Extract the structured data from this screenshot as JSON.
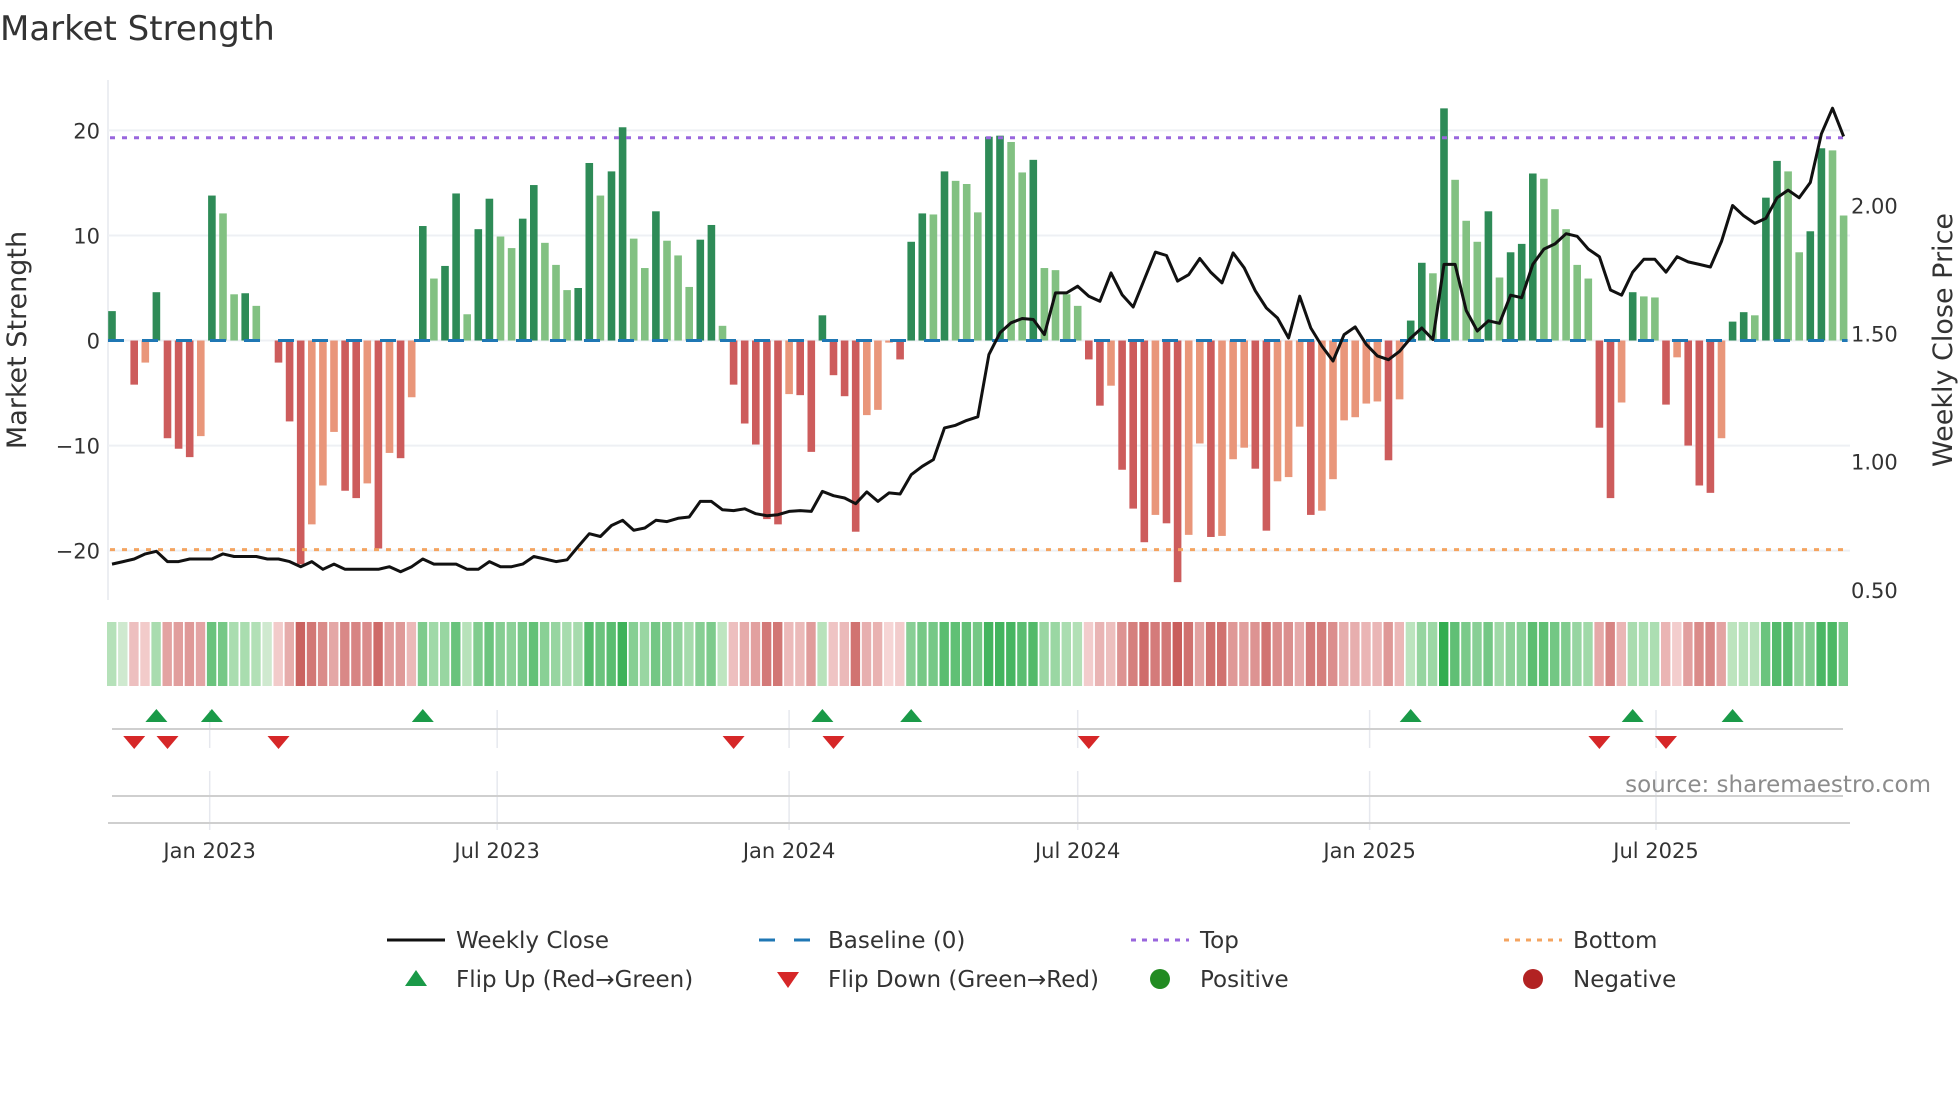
{
  "chart_data": {
    "type": "bar",
    "title": "Market Strength",
    "ylabel": "Market Strength",
    "ylabel_right": "Weekly Close Price",
    "ylim": [
      -24.7,
      24.8
    ],
    "ylim_right": [
      0.46,
      2.49
    ],
    "yticks": [
      {
        "value": 20,
        "label": "20"
      },
      {
        "value": 10,
        "label": "10"
      },
      {
        "value": 0,
        "label": "0"
      },
      {
        "value": -10,
        "label": "−10"
      },
      {
        "value": -20,
        "label": "−20"
      }
    ],
    "yticks_right": [
      {
        "value": 0.5,
        "label": "0.50"
      },
      {
        "value": 1.0,
        "label": "1.00"
      },
      {
        "value": 1.5,
        "label": "1.50"
      },
      {
        "value": 2.0,
        "label": "2.00"
      }
    ],
    "xticks": [
      {
        "week": 8.8,
        "label": "Jan 2023"
      },
      {
        "week": 34.7,
        "label": "Jul 2023"
      },
      {
        "week": 61.0,
        "label": "Jan 2024"
      },
      {
        "week": 87.0,
        "label": "Jul 2024"
      },
      {
        "week": 113.3,
        "label": "Jan 2025"
      },
      {
        "week": 139.1,
        "label": "Jul 2025"
      }
    ],
    "grid": true,
    "top_level": 19.3,
    "bottom_level": -19.9,
    "baseline": 0,
    "series": [
      {
        "name": "Market Strength",
        "type": "bar",
        "values": [
          2.8,
          0,
          -4.2,
          -2.1,
          4.6,
          -9.3,
          -10.3,
          -11.1,
          -9.1,
          13.8,
          12.1,
          4.4,
          4.5,
          3.3,
          0,
          -2.1,
          -7.7,
          -21.3,
          -17.5,
          -13.8,
          -8.7,
          -14.3,
          -15.0,
          -13.6,
          -19.8,
          -10.7,
          -11.2,
          -5.4,
          10.9,
          5.9,
          7.1,
          14.0,
          2.5,
          10.6,
          13.5,
          9.9,
          8.8,
          11.6,
          14.8,
          9.3,
          7.2,
          4.8,
          5.0,
          16.9,
          13.8,
          16.1,
          20.3,
          9.7,
          6.9,
          12.3,
          9.5,
          8.1,
          5.1,
          9.6,
          11.0,
          1.4,
          -4.2,
          -7.9,
          -9.9,
          -17.0,
          -17.5,
          -5.1,
          -5.2,
          -10.6,
          2.4,
          -3.3,
          -5.3,
          -18.2,
          -7.1,
          -6.6,
          -0.2,
          -1.8,
          9.4,
          12.1,
          12.0,
          16.1,
          15.2,
          14.9,
          12.2,
          19.4,
          19.5,
          18.9,
          16.0,
          17.2,
          6.9,
          6.7,
          4.4,
          3.3,
          -1.8,
          -6.2,
          -4.3,
          -12.3,
          -16.0,
          -19.2,
          -16.6,
          -17.4,
          -23.0,
          -18.5,
          -9.8,
          -18.7,
          -18.6,
          -11.3,
          -10.2,
          -12.2,
          -18.1,
          -13.4,
          -13.0,
          -8.2,
          -16.6,
          -16.2,
          -13.2,
          -7.6,
          -7.3,
          -6.0,
          -5.8,
          -11.4,
          -5.6,
          1.9,
          7.4,
          6.4,
          22.1,
          15.3,
          11.4,
          9.4,
          12.3,
          6.0,
          8.4,
          9.2,
          15.9,
          15.4,
          12.5,
          10.6,
          7.2,
          5.9,
          -8.3,
          -15.0,
          -5.9,
          4.6,
          4.2,
          4.1,
          -6.1,
          -1.6,
          -10.0,
          -13.8,
          -14.5,
          -9.3,
          1.8,
          2.7,
          2.4,
          13.6,
          17.1,
          16.1,
          8.4,
          10.4,
          18.3,
          18.1,
          11.9
        ]
      },
      {
        "name": "Weekly Close",
        "type": "line",
        "axis": "right",
        "values": [
          0.6,
          0.61,
          0.62,
          0.64,
          0.65,
          0.61,
          0.61,
          0.62,
          0.62,
          0.62,
          0.64,
          0.63,
          0.63,
          0.63,
          0.62,
          0.62,
          0.61,
          0.59,
          0.61,
          0.58,
          0.6,
          0.58,
          0.58,
          0.58,
          0.58,
          0.59,
          0.57,
          0.59,
          0.62,
          0.6,
          0.6,
          0.6,
          0.58,
          0.58,
          0.61,
          0.59,
          0.59,
          0.6,
          0.63,
          0.62,
          0.61,
          0.617,
          0.669,
          0.719,
          0.708,
          0.751,
          0.771,
          0.732,
          0.741,
          0.771,
          0.766,
          0.779,
          0.784,
          0.845,
          0.845,
          0.812,
          0.809,
          0.816,
          0.797,
          0.789,
          0.793,
          0.806,
          0.809,
          0.806,
          0.884,
          0.867,
          0.858,
          0.836,
          0.882,
          0.845,
          0.878,
          0.874,
          0.949,
          0.982,
          1.008,
          1.132,
          1.142,
          1.161,
          1.175,
          1.418,
          1.503,
          1.542,
          1.559,
          1.555,
          1.496,
          1.659,
          1.659,
          1.685,
          1.646,
          1.626,
          1.737,
          1.652,
          1.604,
          1.711,
          1.818,
          1.805,
          1.705,
          1.73,
          1.793,
          1.739,
          1.698,
          1.815,
          1.757,
          1.667,
          1.6,
          1.561,
          1.483,
          1.646,
          1.522,
          1.451,
          1.393,
          1.496,
          1.526,
          1.458,
          1.413,
          1.398,
          1.431,
          1.483,
          1.522,
          1.477,
          1.77,
          1.77,
          1.59,
          1.51,
          1.55,
          1.54,
          1.65,
          1.64,
          1.77,
          1.83,
          1.85,
          1.89,
          1.88,
          1.83,
          1.8,
          1.67,
          1.65,
          1.74,
          1.79,
          1.79,
          1.74,
          1.8,
          1.78,
          1.77,
          1.76,
          1.86,
          2.0,
          1.96,
          1.93,
          1.95,
          2.03,
          2.06,
          2.03,
          2.09,
          2.28,
          2.38,
          2.27
        ]
      }
    ],
    "flips_up_weeks": [
      4,
      9,
      28,
      64,
      72,
      117,
      137,
      146
    ],
    "flips_down_weeks": [
      2,
      5,
      15,
      56,
      65,
      88,
      134,
      140
    ],
    "legend": {
      "placement": "bottom",
      "items": [
        {
          "label": "Weekly Close",
          "symbol": "line"
        },
        {
          "label": "Baseline (0)",
          "symbol": "dash"
        },
        {
          "label": "Top",
          "symbol": "dot-purple"
        },
        {
          "label": "Bottom",
          "symbol": "dot-orange"
        },
        {
          "label": "Flip Up (Red→Green)",
          "symbol": "triangle-up"
        },
        {
          "label": "Flip Down (Green→Red)",
          "symbol": "triangle-down"
        },
        {
          "label": "Positive",
          "symbol": "circle-green"
        },
        {
          "label": "Negative",
          "symbol": "circle-red"
        }
      ]
    },
    "source": "source: sharemaestro.com",
    "colors": {
      "pos_strong": "#2e8b57",
      "pos_weak": "#82c182",
      "neg_strong": "#cd5c5c",
      "neg_weak": "#e9967a",
      "line": "#111111",
      "baseline": "#1f77b4",
      "top": "#9966dd",
      "bottom": "#f4a460",
      "flip_up": "#1a9a48",
      "flip_down": "#d62728",
      "positive": "#228b22",
      "negative": "#b22222",
      "grid": "#eef0f4"
    }
  }
}
